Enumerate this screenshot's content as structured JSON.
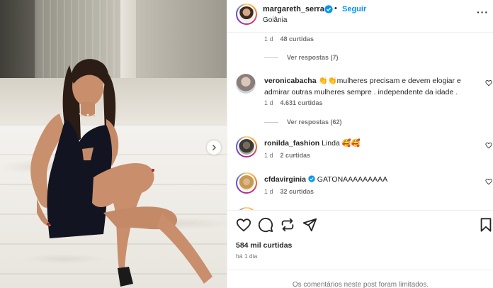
{
  "post": {
    "username": "margareth_serrao",
    "separator": "•",
    "follow_label": "Seguir",
    "location": "Goiânia",
    "likes": "584 mil curtidas",
    "time_ago": "há 1 dia",
    "comments_limited": "Os comentários neste post foram limitados."
  },
  "comments": {
    "top_meta": {
      "time": "1 d",
      "likes": "48 curtidas"
    },
    "top_replies": "Ver respostas (7)",
    "items": [
      {
        "user": "veronicabacha",
        "emoji": "👏👏",
        "text": "mulheres precisam e devem elogiar e admirar outras mulheres sempre . independente da idade .",
        "time": "1 d",
        "likes": "4.631 curtidas",
        "replies": "Ver respostas (62)"
      },
      {
        "user": "ronilda_fashion",
        "text": "Linda",
        "emoji": "🥰🥰",
        "time": "1 d",
        "likes": "2 curtidas"
      },
      {
        "user": "cfdavirginia",
        "verified": true,
        "text": "GATONAAAAAAAAA",
        "time": "1 d",
        "likes": "32 curtidas"
      }
    ]
  },
  "icons": {
    "like": "heart-icon",
    "comment": "comment-icon",
    "share": "repost-icon",
    "send": "send-icon",
    "save": "bookmark-icon",
    "more": "more-options-icon",
    "next": "chevron-right-icon",
    "verified": "verified-badge-icon"
  },
  "colors": {
    "accent": "#0095f6",
    "text": "#262626",
    "muted": "#737373",
    "verified": "#0095f6"
  }
}
